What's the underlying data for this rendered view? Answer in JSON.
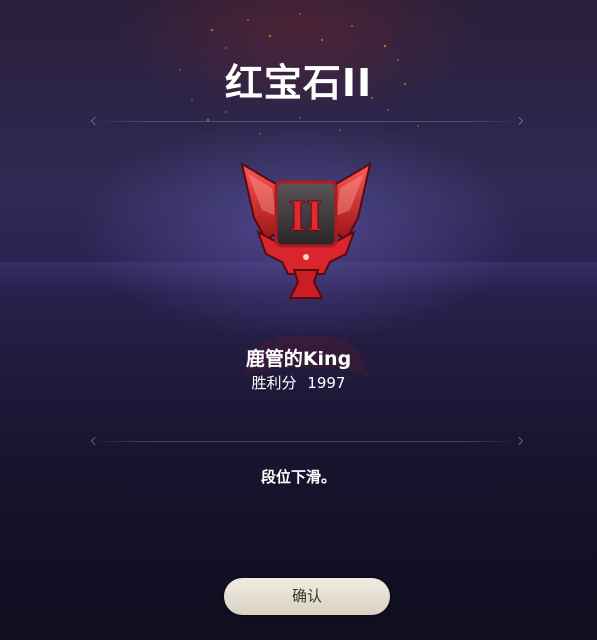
{
  "rank": {
    "title": "红宝石II",
    "emblem_icon": "ruby-rank-emblem-icon",
    "tier_numeral": "II",
    "color": "#c8262a"
  },
  "player": {
    "name": "鹿管的King",
    "score_label": "胜利分",
    "score_value": "1997"
  },
  "message": "段位下滑。",
  "confirm_button": {
    "label": "确认"
  }
}
